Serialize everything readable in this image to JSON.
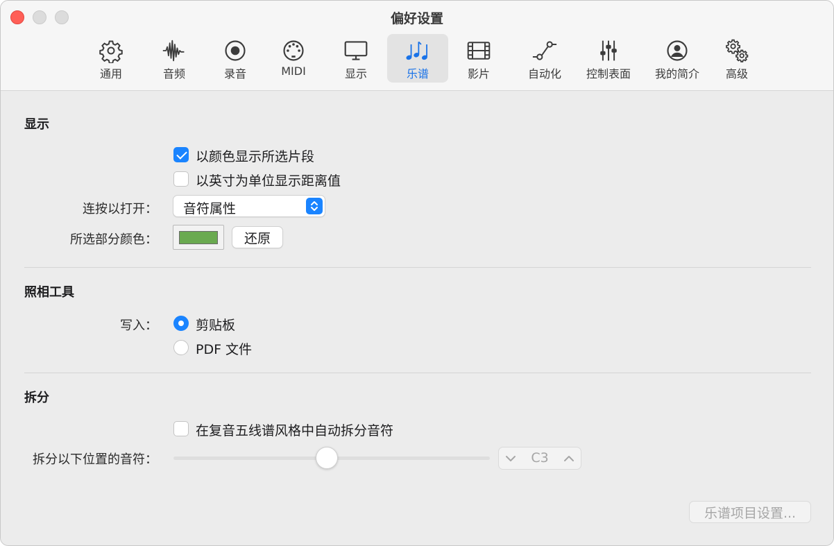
{
  "window": {
    "title": "偏好设置"
  },
  "tabs": [
    {
      "label": "通用",
      "icon": "gear-icon"
    },
    {
      "label": "音频",
      "icon": "waveform-icon"
    },
    {
      "label": "录音",
      "icon": "record-icon"
    },
    {
      "label": "MIDI",
      "icon": "midi-connector-icon"
    },
    {
      "label": "显示",
      "icon": "monitor-icon"
    },
    {
      "label": "乐谱",
      "icon": "music-notes-icon",
      "active": true
    },
    {
      "label": "影片",
      "icon": "film-icon"
    },
    {
      "label": "自动化",
      "icon": "automation-curve-icon"
    },
    {
      "label": "控制表面",
      "icon": "sliders-icon"
    },
    {
      "label": "我的简介",
      "icon": "person-icon"
    },
    {
      "label": "高级",
      "icon": "gears-icon"
    }
  ],
  "display": {
    "section_title": "显示",
    "checkbox_color_label": "以颜色显示所选片段",
    "checkbox_color_checked": true,
    "checkbox_inches_label": "以英寸为单位显示距离值",
    "checkbox_inches_checked": false,
    "double_click_label": "连按以打开：",
    "double_click_value": "音符属性",
    "selection_color_label": "所选部分颜色：",
    "selection_color": "#6aaa50",
    "restore_button": "还原"
  },
  "camera": {
    "section_title": "照相工具",
    "write_label": "写入：",
    "option_clipboard": "剪贴板",
    "option_pdf": "PDF 文件",
    "selected": "clipboard"
  },
  "split": {
    "section_title": "拆分",
    "auto_split_label": "在复音五线谱风格中自动拆分音符",
    "auto_split_checked": false,
    "split_below_label": "拆分以下位置的音符：",
    "split_note_value": "C3",
    "slider_fraction": 0.5
  },
  "footer": {
    "score_project_settings_button": "乐谱项目设置..."
  },
  "colors": {
    "accent": "#1a84ff",
    "close": "#ff5f57"
  }
}
